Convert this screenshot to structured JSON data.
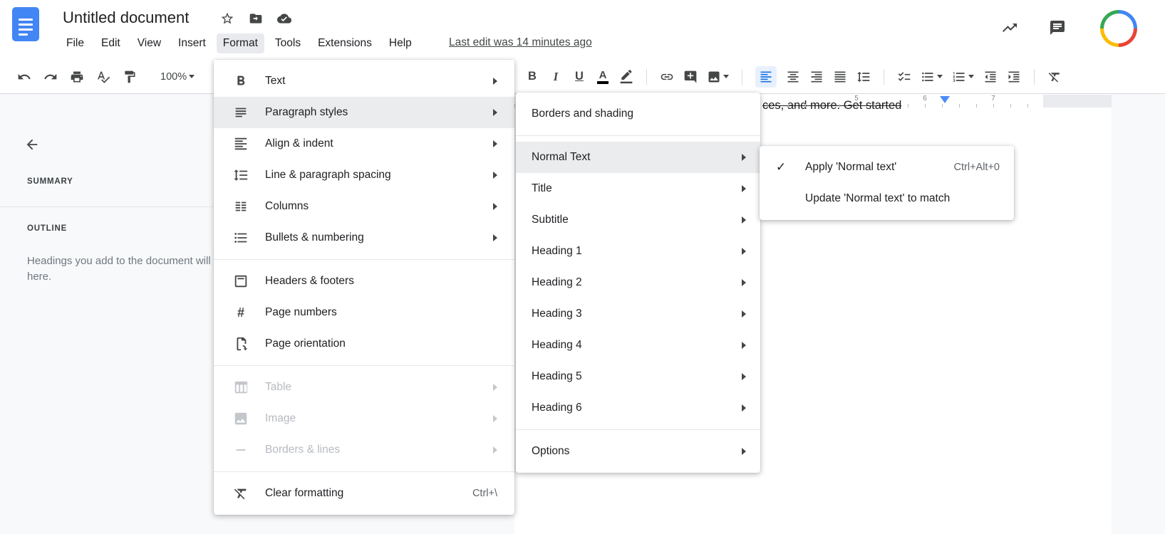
{
  "header": {
    "doc_title": "Untitled document",
    "menu_items": [
      "File",
      "Edit",
      "View",
      "Insert",
      "Format",
      "Tools",
      "Extensions",
      "Help"
    ],
    "last_edit": "Last edit was 14 minutes ago",
    "icons": [
      "docs-logo",
      "star-icon",
      "move-folder-icon",
      "cloud-saved-icon",
      "activity-icon",
      "comments-icon",
      "avatar"
    ]
  },
  "toolbar": {
    "zoom": "100%",
    "bold": "B",
    "italic": "I",
    "underline": "U",
    "text_color": "A",
    "icons": [
      "undo-icon",
      "redo-icon",
      "print-icon",
      "spellcheck-icon",
      "paint-format-icon",
      "link-icon",
      "add-comment-icon",
      "insert-image-icon",
      "align-left-icon",
      "align-center-icon",
      "align-right-icon",
      "justify-icon",
      "line-spacing-icon",
      "checklist-icon",
      "bulleted-list-icon",
      "numbered-list-icon",
      "decrease-indent-icon",
      "increase-indent-icon",
      "clear-formatting-icon"
    ],
    "active_tool": "align-left"
  },
  "sidebar": {
    "summary_label": "SUMMARY",
    "outline_label": "OUTLINE",
    "outline_hint": "Headings you add to the document will appear here."
  },
  "format_menu": {
    "items": [
      {
        "label": "Text",
        "icon": "bold-icon",
        "submenu": true
      },
      {
        "label": "Paragraph styles",
        "icon": "paragraph-styles-icon",
        "submenu": true,
        "highlighted": true
      },
      {
        "label": "Align & indent",
        "icon": "align-indent-icon",
        "submenu": true
      },
      {
        "label": "Line & paragraph spacing",
        "icon": "line-spacing-icon",
        "submenu": true
      },
      {
        "label": "Columns",
        "icon": "columns-icon",
        "submenu": true
      },
      {
        "label": "Bullets & numbering",
        "icon": "bullets-numbering-icon",
        "submenu": true
      },
      {
        "label": "Headers & footers",
        "icon": "headers-footers-icon"
      },
      {
        "label": "Page numbers",
        "icon": "page-numbers-icon"
      },
      {
        "label": "Page orientation",
        "icon": "page-orientation-icon"
      },
      {
        "label": "Table",
        "icon": "table-icon",
        "submenu": true,
        "disabled": true
      },
      {
        "label": "Image",
        "icon": "image-icon",
        "submenu": true,
        "disabled": true
      },
      {
        "label": "Borders & lines",
        "icon": "borders-lines-icon",
        "submenu": true,
        "disabled": true
      },
      {
        "label": "Clear formatting",
        "icon": "clear-formatting-icon",
        "shortcut": "Ctrl+\\"
      }
    ]
  },
  "paragraph_styles_menu": {
    "items": [
      {
        "label": "Borders and shading"
      },
      {
        "label": "Normal Text",
        "submenu": true,
        "highlighted": true
      },
      {
        "label": "Title",
        "submenu": true
      },
      {
        "label": "Subtitle",
        "submenu": true
      },
      {
        "label": "Heading 1",
        "submenu": true
      },
      {
        "label": "Heading 2",
        "submenu": true
      },
      {
        "label": "Heading 3",
        "submenu": true
      },
      {
        "label": "Heading 4",
        "submenu": true
      },
      {
        "label": "Heading 5",
        "submenu": true
      },
      {
        "label": "Heading 6",
        "submenu": true
      },
      {
        "label": "Options",
        "submenu": true
      }
    ]
  },
  "normal_text_menu": {
    "items": [
      {
        "label": "Apply 'Normal text'",
        "shortcut": "Ctrl+Alt+0",
        "checked": true
      },
      {
        "label": "Update 'Normal text' to match",
        "checked": false
      }
    ]
  },
  "ruler": {
    "numbers": [
      "5",
      "6",
      "7"
    ]
  },
  "page": {
    "text_fragment": "ces, and more. Get started"
  },
  "colors": {
    "accent": "#1a73e8",
    "active_tool_bg": "#e8f0fe",
    "menu_highlight": "#ebecee",
    "docs_blue": "#4285f4"
  }
}
